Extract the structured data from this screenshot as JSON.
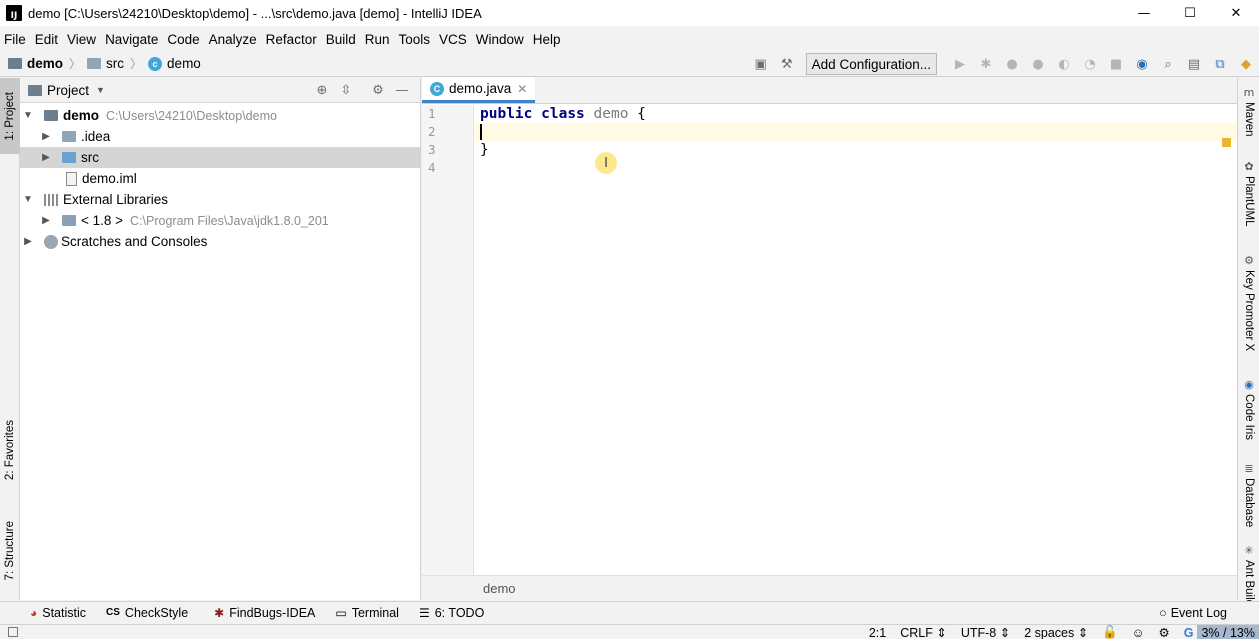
{
  "window": {
    "title": "demo [C:\\Users\\24210\\Desktop\\demo] - ...\\src\\demo.java [demo] - IntelliJ IDEA",
    "app_icon": "IJ",
    "minimize": "—",
    "maximize": "☐",
    "close": "✕"
  },
  "menu": [
    "File",
    "Edit",
    "View",
    "Navigate",
    "Code",
    "Analyze",
    "Refactor",
    "Build",
    "Run",
    "Tools",
    "VCS",
    "Window",
    "Help"
  ],
  "breadcrumb": [
    {
      "label": "demo",
      "icon": "module-folder-icon"
    },
    {
      "label": "src",
      "icon": "folder-icon"
    },
    {
      "label": "demo",
      "icon": "class-icon"
    }
  ],
  "toolbar": {
    "add_configuration": "Add Configuration..."
  },
  "left_tabs": {
    "project": "1: Project",
    "favorites": "2: Favorites",
    "structure": "7: Structure"
  },
  "project_panel": {
    "title": "Project",
    "tree": [
      {
        "name": "demo",
        "path": "C:\\Users\\24210\\Desktop\\demo",
        "level": 0,
        "expanded": true,
        "icon": "module-folder-icon"
      },
      {
        "name": ".idea",
        "path": "",
        "level": 1,
        "expanded": false,
        "icon": "folder-icon"
      },
      {
        "name": "src",
        "path": "",
        "level": 1,
        "expanded": false,
        "icon": "source-folder-icon",
        "selected": true
      },
      {
        "name": "demo.iml",
        "path": "",
        "level": 1,
        "icon": "file-icon"
      },
      {
        "name": "External Libraries",
        "path": "",
        "level": 0,
        "expanded": true,
        "icon": "library-icon"
      },
      {
        "name": "< 1.8 >",
        "path": "C:\\Program Files\\Java\\jdk1.8.0_201",
        "level": 1,
        "expanded": false,
        "icon": "jdk-icon"
      },
      {
        "name": "Scratches and Consoles",
        "path": "",
        "level": 0,
        "expanded": false,
        "icon": "scratch-icon"
      }
    ]
  },
  "editor": {
    "tab_label": "demo.java",
    "tab_icon": "C",
    "line_numbers": [
      "1",
      "2",
      "3",
      "4"
    ],
    "code": {
      "kw_public": "public",
      "kw_class": "class",
      "class_name": "demo",
      "open_brace": "{",
      "close_brace": "}"
    },
    "footer_breadcrumb": "demo"
  },
  "right_tabs": [
    "Maven",
    "PlantUML",
    "Key Promoter X",
    "Code Iris",
    "Database",
    "Ant Build"
  ],
  "bottom_tools": [
    {
      "label": "Statistic",
      "icon": "statistic-icon"
    },
    {
      "label": "CheckStyle",
      "icon": "checkstyle-icon"
    },
    {
      "label": "FindBugs-IDEA",
      "icon": "findbugs-icon"
    },
    {
      "label": "Terminal",
      "icon": "terminal-icon"
    },
    {
      "label": "6: TODO",
      "icon": "todo-icon"
    }
  ],
  "event_log": "Event Log",
  "status": {
    "position": "2:1",
    "line_sep": "CRLF ⇕",
    "encoding": "UTF-8 ⇕",
    "indent": "2 spaces ⇕",
    "memory": "3% / 13%"
  }
}
